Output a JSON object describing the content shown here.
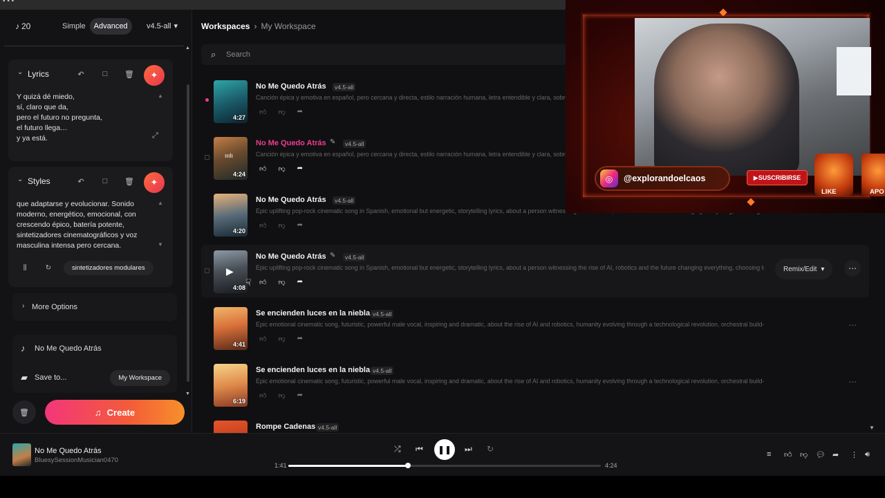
{
  "left": {
    "credits": "20",
    "mode": {
      "simple": "Simple",
      "advanced": "Advanced"
    },
    "model": "v4.5-all",
    "lyrics": {
      "title": "Lyrics",
      "text": "Y quizá dé miedo,\nsí, claro que da,\npero el futuro no pregunta,\nel futuro llega…\ny ya está."
    },
    "styles": {
      "title": "Styles",
      "text": "que adaptarse y evolucionar. Sonido\nmoderno, energético, emocional, con\ncrescendo épico, batería potente,\nsintetizadores cinematográficos y voz\nmasculina intensa pero cercana.",
      "tag": "sintetizadores modulares"
    },
    "more_options": "More Options",
    "song_name": "No Me Quedo Atrás",
    "save_to": "Save to...",
    "workspace_chip": "My Workspace",
    "create": "Create"
  },
  "main": {
    "breadcrumb": {
      "root": "Workspaces",
      "current": "My Workspace"
    },
    "search_placeholder": "Search",
    "tracks": [
      {
        "title": "No Me Quedo Atrás",
        "badge": "v4.5-all",
        "duration": "4:27",
        "desc": "Canción épica y emotiva en español, pero cercana y directa, estilo narración humana, letra entendible y clara, sobre cómo",
        "state": "playing-dot"
      },
      {
        "title": "No Me Quedo Atrás",
        "badge": "v4.5-all",
        "duration": "4:24",
        "desc": "Canción épica y emotiva en español, pero cercana y directa, estilo narración humana, letra entendible y clara, sobre cómo",
        "state": "current"
      },
      {
        "title": "No Me Quedo Atrás",
        "badge": "v4.5-all",
        "duration": "4:20",
        "desc": "Epic uplifting pop-rock cinematic song in Spanish, emotional but energetic, storytelling lyrics, about a person witnessing the rise of AI, robotics and the future changing everything, choosing to evol...",
        "state": ""
      },
      {
        "title": "No Me Quedo Atrás",
        "badge": "v4.5-all",
        "duration": "4:08",
        "desc": "Epic uplifting pop-rock cinematic song in Spanish, emotional but energetic, storytelling lyrics, about a person witnessing the rise of AI, robotics and the future changing everything, choosing to evol...",
        "state": "hover"
      },
      {
        "title": "Se encienden luces en la niebla,",
        "badge": "v4.5-all",
        "duration": "4:41",
        "desc": "Epic emotional cinematic song, futuristic, powerful male vocal, inspiring and dramatic, about the rise of AI and robotics, humanity evolving through a technological revolution, orchestral build-up, de...",
        "state": ""
      },
      {
        "title": "Se encienden luces en la niebla,",
        "badge": "v4.5-all",
        "duration": "6:19",
        "desc": "Epic emotional cinematic song, futuristic, powerful male vocal, inspiring and dramatic, about the rise of AI and robotics, humanity evolving through a technological revolution, orchestral build-up, de...",
        "state": ""
      },
      {
        "title": "Rompe Cadenas",
        "badge": "v4.5-all",
        "duration": "",
        "desc": "",
        "state": ""
      }
    ],
    "remix_label": "Remix/Edit"
  },
  "player": {
    "title": "No Me Quedo Atrás",
    "artist": "BluesySessionMusician0470",
    "elapsed": "1:41",
    "total": "4:24",
    "progress": 0.3826
  },
  "overlay": {
    "handle": "@explorandoelcaos",
    "subscribe": "SUSCRIBIRSE",
    "like": "LIKE",
    "apo": "APO"
  },
  "colors": {
    "accent_pink": "#ee3d8f",
    "create_gradient_start": "#f3367a",
    "create_gradient_end": "#f7902a"
  }
}
